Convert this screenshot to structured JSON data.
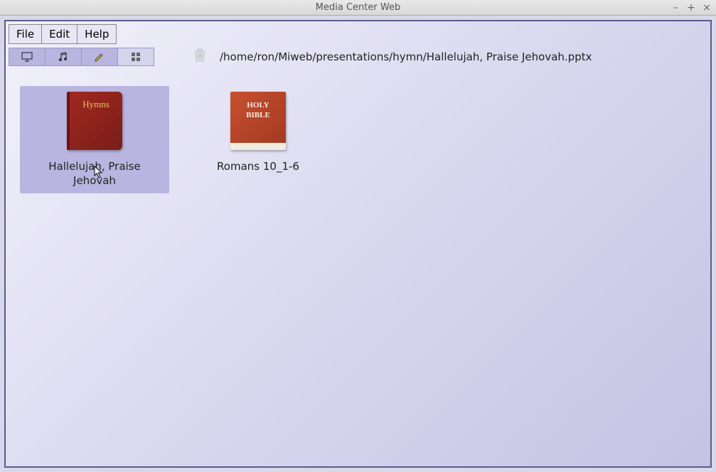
{
  "window": {
    "title": "Media Center Web"
  },
  "menubar": {
    "file": "File",
    "edit": "Edit",
    "help": "Help"
  },
  "toolbar": {
    "path": "/home/ron/Miweb/presentations/hymn/Hallelujah, Praise Jehovah.pptx"
  },
  "items": [
    {
      "label": "Hallelujah, Praise Jehovah",
      "selected": true,
      "thumb_type": "hymns"
    },
    {
      "label": "Romans 10_1-6",
      "selected": false,
      "thumb_type": "bible"
    }
  ]
}
